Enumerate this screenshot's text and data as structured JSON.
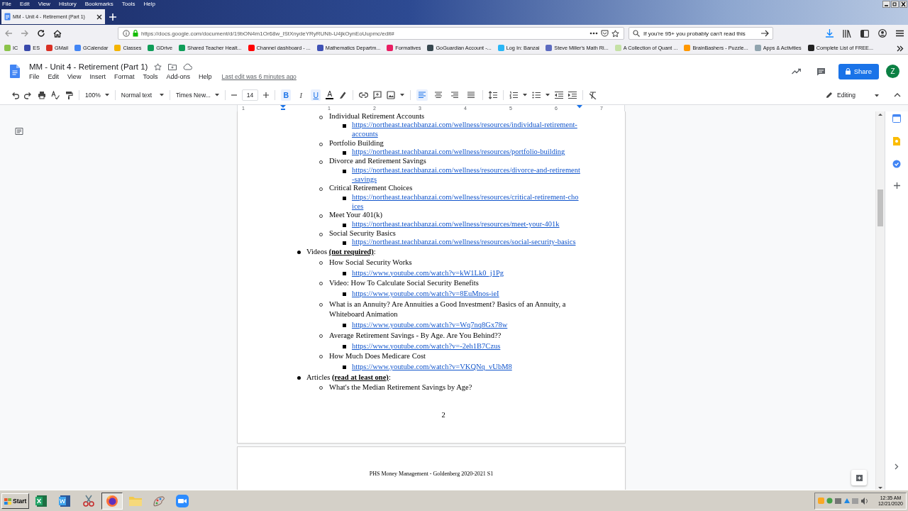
{
  "menu_bar": [
    "File",
    "Edit",
    "View",
    "History",
    "Bookmarks",
    "Tools",
    "Help"
  ],
  "browser_tab": {
    "title": "MM - Unit 4 - Retirement (Part 1)",
    "selected": true
  },
  "address_bar": {
    "url": "https://docs.google.com/document/d/19bON4m1Or68w_lStXnydeYRyRUNb-U4jkOynEoUupmc/edit#"
  },
  "search_bar": {
    "value": "If you're 95+ you probably can't read this"
  },
  "bookmarks": [
    {
      "label": "IC",
      "color": "#8bc34a"
    },
    {
      "label": "ES",
      "color": "#3949ab"
    },
    {
      "label": "GMail",
      "color": "#d93025"
    },
    {
      "label": "GCalendar",
      "color": "#4285f4"
    },
    {
      "label": "Classes",
      "color": "#f4b400"
    },
    {
      "label": "GDrive",
      "color": "#0f9d58"
    },
    {
      "label": "Shared Teacher Healt...",
      "color": "#0f9d58"
    },
    {
      "label": "Channel dashboard - ...",
      "color": "#ff0000"
    },
    {
      "label": "Mathematics Departm...",
      "color": "#3f51b5"
    },
    {
      "label": "Formatives",
      "color": "#e91e63"
    },
    {
      "label": "GoGuardian Account -...",
      "color": "#37474f"
    },
    {
      "label": "Log In: Banzai",
      "color": "#29b6f6"
    },
    {
      "label": "Steve Miller's Math Ri...",
      "color": "#5c6bc0"
    },
    {
      "label": "A Collection of Quant ...",
      "color": "#c5e1a5"
    },
    {
      "label": "BrainBashers - Puzzle...",
      "color": "#ff9800"
    },
    {
      "label": "Apps & Activities",
      "color": "#90a4ae"
    },
    {
      "label": "Complete List of FREE...",
      "color": "#212121"
    }
  ],
  "docs_header": {
    "title": "MM - Unit 4 - Retirement (Part 1)",
    "menus": [
      "File",
      "Edit",
      "View",
      "Insert",
      "Format",
      "Tools",
      "Add-ons",
      "Help"
    ],
    "last_edit": "Last edit was 6 minutes ago",
    "share_label": "Share",
    "avatar_letter": "Z"
  },
  "toolbar": {
    "zoom": "100%",
    "style": "Normal text",
    "font": "Times New...",
    "font_size": "14",
    "text_format": [
      {
        "kind": "bold",
        "label": "B",
        "on": true
      },
      {
        "kind": "italic",
        "label": "I",
        "on": false
      },
      {
        "kind": "underline",
        "label": "U",
        "on": true
      }
    ],
    "text_color_label": "A",
    "alignment": [
      {
        "kind": "left",
        "selected": true
      },
      {
        "kind": "center",
        "selected": false
      },
      {
        "kind": "right",
        "selected": false
      },
      {
        "kind": "justify",
        "selected": false
      }
    ],
    "mode": "Editing"
  },
  "ruler_marks": [
    "1",
    "1",
    "2",
    "3",
    "4",
    "5",
    "6",
    "7"
  ],
  "outline": [
    {
      "children": [
        {
          "text": "Individual Retirement Accounts",
          "children": [
            {
              "kind": "link",
              "text": "https://northeast.teachbanzai.com/wellness/resources/individual-retirement-accounts"
            }
          ]
        },
        {
          "text": "Portfolio Building",
          "children": [
            {
              "kind": "link",
              "text": "https://northeast.teachbanzai.com/wellness/resources/portfolio-building"
            }
          ]
        },
        {
          "text": "Divorce and Retirement Savings",
          "children": [
            {
              "kind": "link",
              "text": "https://northeast.teachbanzai.com/wellness/resources/divorce-and-retirement-savings"
            }
          ]
        },
        {
          "text": "Critical Retirement Choices",
          "children": [
            {
              "kind": "link",
              "text": "https://northeast.teachbanzai.com/wellness/resources/critical-retirement-choices"
            }
          ]
        },
        {
          "text": "Meet Your 401(k)",
          "children": [
            {
              "kind": "link",
              "text": "https://northeast.teachbanzai.com/wellness/resources/meet-your-401k"
            }
          ]
        },
        {
          "text": "Social Security Basics",
          "children": [
            {
              "kind": "link",
              "text": "https://northeast.teachbanzai.com/wellness/resources/social-security-basics"
            }
          ]
        }
      ]
    },
    {
      "text": "Videos **(not required)**:",
      "children": [
        {
          "text": "How Social Security Works",
          "children": [
            {
              "kind": "link",
              "text": "https://www.youtube.com/watch?v=kW1Lk0_j1Pg"
            }
          ]
        },
        {
          "text": "Video: How To Calculate Social Security Benefits",
          "children": [
            {
              "kind": "link",
              "text": "https://www.youtube.com/watch?v=8EuMnos-ieI"
            }
          ]
        },
        {
          "text": "What is an Annuity? Are Annuities a Good Investment? Basics of an Annuity, a Whiteboard Animation",
          "children": [
            {
              "kind": "link",
              "text": "https://www.youtube.com/watch?v=Wq7nq8Gx78w"
            }
          ]
        },
        {
          "text": "Average Retirement Savings - By Age. Are You Behind??",
          "children": [
            {
              "kind": "link",
              "text": "https://www.youtube.com/watch?v=-2eh1B7Czus"
            }
          ]
        },
        {
          "text": "How Much Does Medicare Cost",
          "children": [
            {
              "kind": "link",
              "text": "https://www.youtube.com/watch?v=VKQNq_vUbM8"
            }
          ]
        }
      ]
    },
    {
      "text": "Articles **(read at least one)**:",
      "children": [
        {
          "text": "What's the Median Retirement Savings by Age?"
        }
      ]
    }
  ],
  "page_number": "2",
  "footer": "PHS Money Management - Goldenberg 2020-2021 S1",
  "taskbar": {
    "start_label": "Start",
    "apps": [
      {
        "kind": "excel",
        "selected": false
      },
      {
        "kind": "word",
        "selected": false
      },
      {
        "kind": "snipping",
        "selected": false
      },
      {
        "kind": "firefox",
        "selected": true
      },
      {
        "kind": "folder",
        "selected": false
      },
      {
        "kind": "paint",
        "selected": false
      },
      {
        "kind": "zoom",
        "selected": false
      }
    ],
    "time": "12:35 AM",
    "date": "12/21/2020"
  }
}
